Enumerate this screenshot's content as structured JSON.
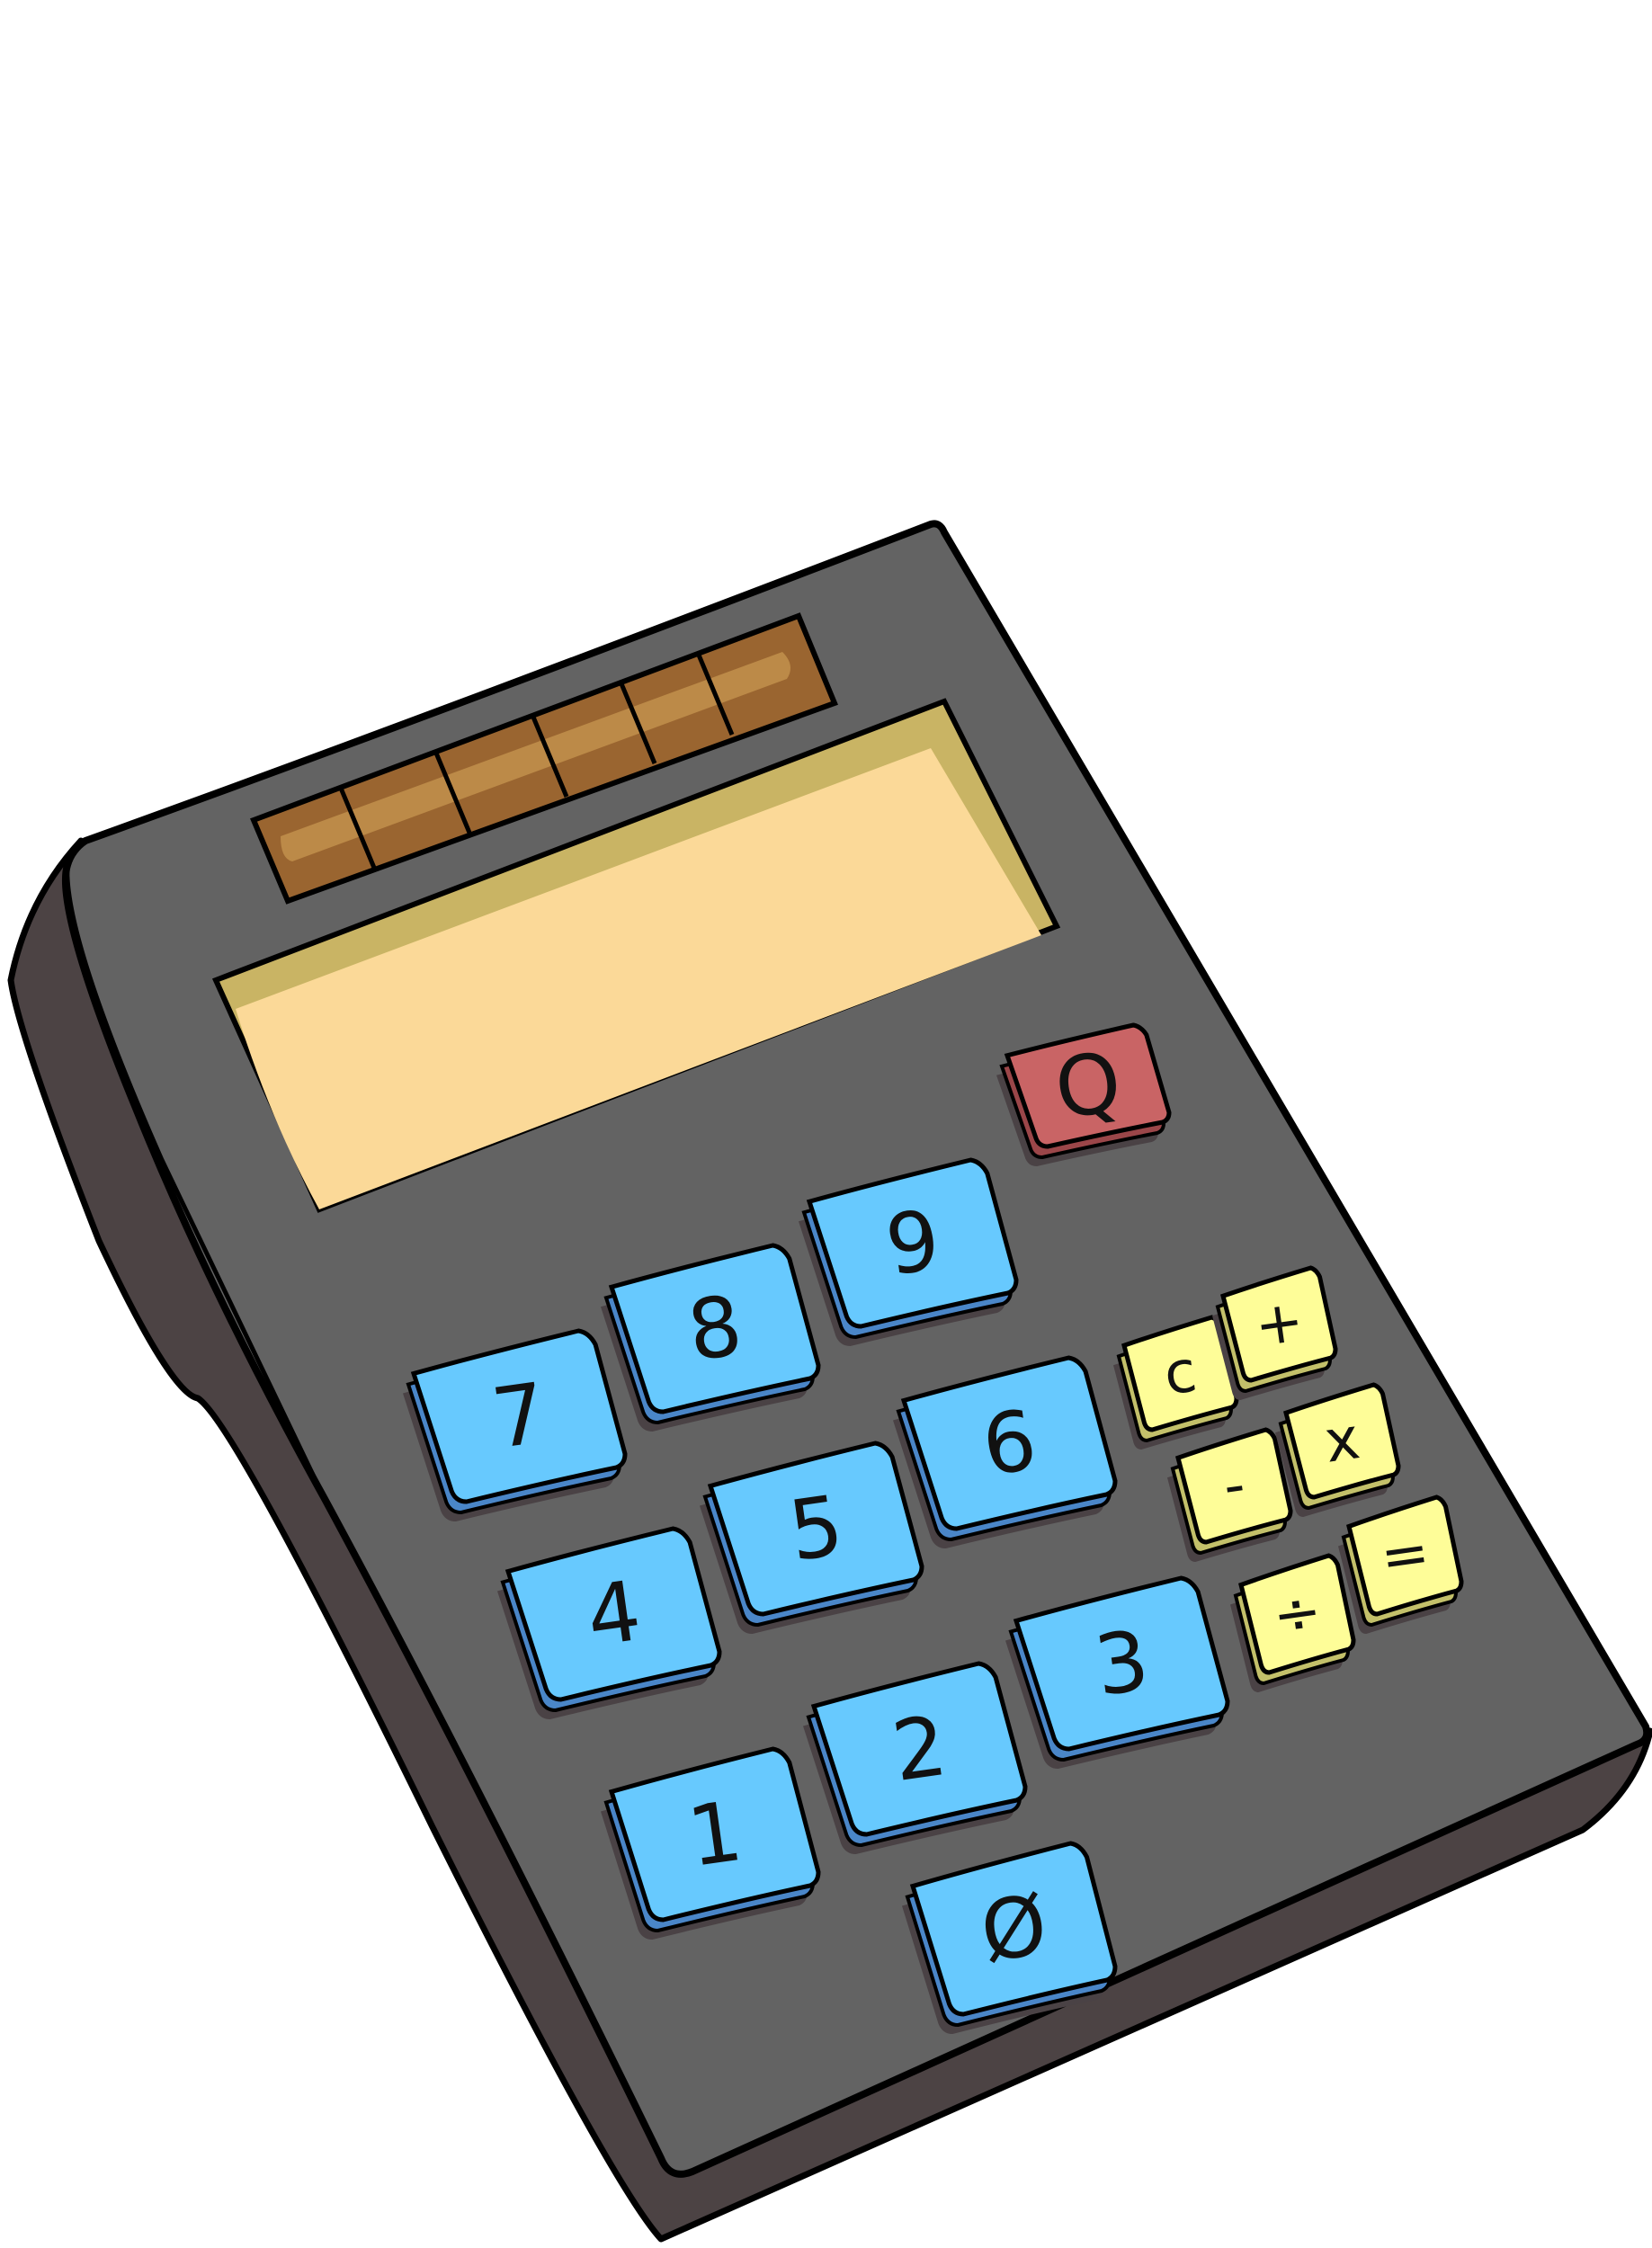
{
  "colors": {
    "body_top": "#636363",
    "body_side": "#4c4344",
    "outline": "#000000",
    "solar_frame": "#9a6530",
    "solar_cell": "#bc8a48",
    "screen_bezel": "#c9b464",
    "screen": "#fbd998",
    "digit_key": "#67c9fe",
    "digit_key_side": "#4a86c8",
    "op_key": "#fefd98",
    "op_key_side": "#c3c06a",
    "power_key": "#c96465",
    "power_key_side": "#9b4649",
    "key_shadow": "#4a4245"
  },
  "keys": {
    "power": "Q",
    "d7": "7",
    "d8": "8",
    "d9": "9",
    "d4": "4",
    "d5": "5",
    "d6": "6",
    "d1": "1",
    "d2": "2",
    "d3": "3",
    "d0": "Ø",
    "clear": "c",
    "plus": "+",
    "minus": "-",
    "times": "x",
    "divide": "÷",
    "equals": "="
  }
}
